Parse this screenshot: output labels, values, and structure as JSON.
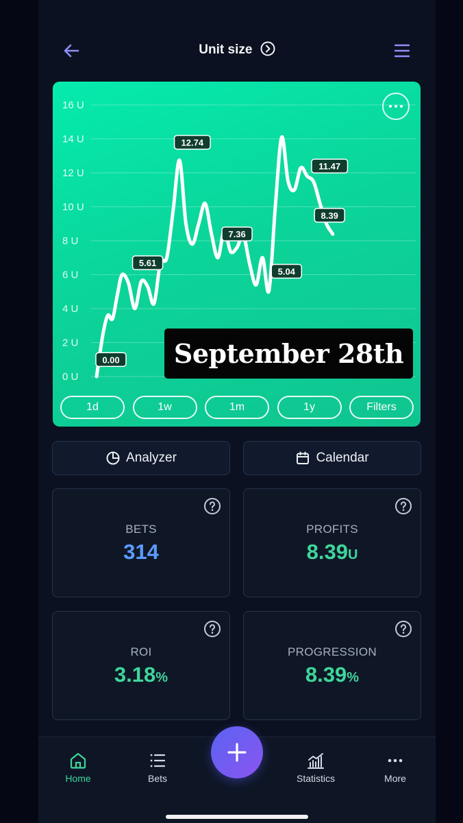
{
  "header": {
    "title": "Unit size"
  },
  "chart_data": {
    "type": "line",
    "x_unit": "bet index",
    "y_tick_labels": [
      "16 U",
      "14 U",
      "12 U",
      "10 U",
      "8 U",
      "6 U",
      "4 U",
      "2 U",
      "0 U"
    ],
    "y_ticks": [
      16,
      14,
      12,
      10,
      8,
      6,
      4,
      2,
      0
    ],
    "ylim": [
      0,
      16
    ],
    "xlim": [
      0,
      100
    ],
    "grid": true,
    "series": [
      {
        "values_x": [
          0,
          2,
          3.5,
          5,
          6.5,
          8,
          10,
          12,
          14,
          16,
          18,
          20,
          22,
          24,
          26,
          28,
          30,
          32,
          34,
          36,
          38,
          40,
          42,
          44,
          46,
          48,
          50,
          52,
          54,
          56,
          58,
          60,
          62,
          64,
          66,
          68,
          70,
          72,
          74,
          76,
          78,
          80,
          82,
          84,
          86,
          88,
          90,
          92,
          94,
          96,
          98,
          100
        ],
        "values_y": [
          0,
          2.5,
          3.6,
          3.4,
          4.8,
          6.0,
          5.5,
          4.0,
          5.6,
          5.3,
          4.3,
          6.7,
          7.0,
          9.8,
          12.74,
          9.0,
          7.8,
          9.0,
          10.2,
          8.4,
          7.0,
          8.6,
          7.36,
          7.6,
          8.3,
          6.6,
          5.4,
          7.0,
          5.04,
          10.0,
          14.1,
          11.5,
          11.0,
          12.3,
          11.8,
          11.47,
          10.2,
          9.0,
          8.39,
          8.39,
          8.39,
          8.39,
          8.39,
          8.39,
          8.39,
          8.39,
          8.39,
          8.39,
          8.39,
          8.39,
          8.39,
          8.39
        ]
      }
    ],
    "labels": [
      {
        "text": "0.00",
        "x": 4.5,
        "y": 1.0
      },
      {
        "text": "5.61",
        "x": 16,
        "y": 6.7
      },
      {
        "text": "12.74",
        "x": 30,
        "y": 13.8
      },
      {
        "text": "7.36",
        "x": 44,
        "y": 8.4
      },
      {
        "text": "5.04",
        "x": 59.5,
        "y": 6.2
      },
      {
        "text": "11.47",
        "x": 73,
        "y": 12.4
      },
      {
        "text": "8.39",
        "x": 73,
        "y": 9.5
      }
    ],
    "overlay_caption": "September 28th"
  },
  "ranges": [
    "1d",
    "1w",
    "1m",
    "1y",
    "Filters"
  ],
  "actions": {
    "analyzer": "Analyzer",
    "calendar": "Calendar"
  },
  "stats": {
    "bets": {
      "label": "BETS",
      "value": "314"
    },
    "profits": {
      "label": "PROFITS",
      "value": "8.39",
      "unit": "U"
    },
    "roi": {
      "label": "ROI",
      "value": "3.18",
      "unit": "%"
    },
    "progression": {
      "label": "PROGRESSION",
      "value": "8.39",
      "unit": "%"
    }
  },
  "nav": {
    "home": "Home",
    "bets": "Bets",
    "statistics": "Statistics",
    "more": "More"
  },
  "colors": {
    "accent_green": "#3fd69a",
    "accent_blue": "#5b9cff",
    "chart_bg": "#05ebad",
    "fab": "#6b5cf1"
  }
}
